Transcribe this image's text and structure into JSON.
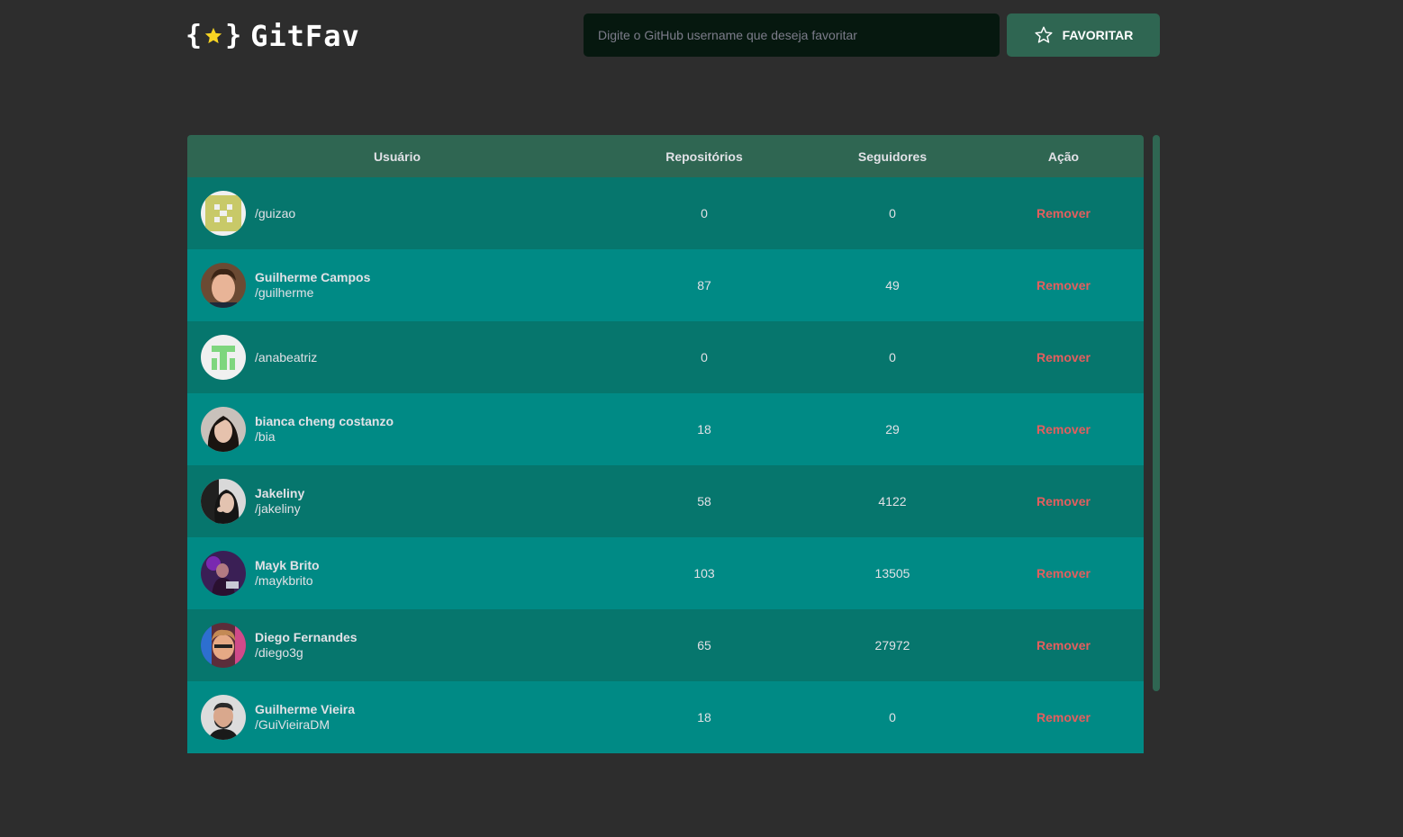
{
  "header": {
    "logo_text": "GitFav",
    "logo_icon": "star-braces-icon",
    "search_placeholder": "Digite o GitHub username que deseja favoritar",
    "favorite_button_label": "FAVORITAR",
    "favorite_button_icon": "star-outline-icon"
  },
  "colors": {
    "background": "#2d2d2d",
    "header_row": "#2f6652",
    "row_odd": "#06766d",
    "row_even": "#008a85",
    "remove_text": "#e45e5e",
    "star": "#f7d423"
  },
  "table": {
    "headers": {
      "user": "Usuário",
      "repos": "Repositórios",
      "followers": "Seguidores",
      "action": "Ação"
    },
    "rows": [
      {
        "name": "",
        "login": "/guizao",
        "repos": "0",
        "followers": "0",
        "action": "Remover",
        "avatar": "identicon-olive"
      },
      {
        "name": "Guilherme Campos",
        "login": "/guilherme",
        "repos": "87",
        "followers": "49",
        "action": "Remover",
        "avatar": "photo"
      },
      {
        "name": "",
        "login": "/anabeatriz",
        "repos": "0",
        "followers": "0",
        "action": "Remover",
        "avatar": "identicon-green"
      },
      {
        "name": "bianca cheng costanzo",
        "login": "/bia",
        "repos": "18",
        "followers": "29",
        "action": "Remover",
        "avatar": "photo"
      },
      {
        "name": "Jakeliny",
        "login": "/jakeliny",
        "repos": "58",
        "followers": "4122",
        "action": "Remover",
        "avatar": "photo"
      },
      {
        "name": "Mayk Brito",
        "login": "/maykbrito",
        "repos": "103",
        "followers": "13505",
        "action": "Remover",
        "avatar": "photo"
      },
      {
        "name": "Diego Fernandes",
        "login": "/diego3g",
        "repos": "65",
        "followers": "27972",
        "action": "Remover",
        "avatar": "photo"
      },
      {
        "name": "Guilherme Vieira",
        "login": "/GuiVieiraDM",
        "repos": "18",
        "followers": "0",
        "action": "Remover",
        "avatar": "photo"
      }
    ]
  }
}
